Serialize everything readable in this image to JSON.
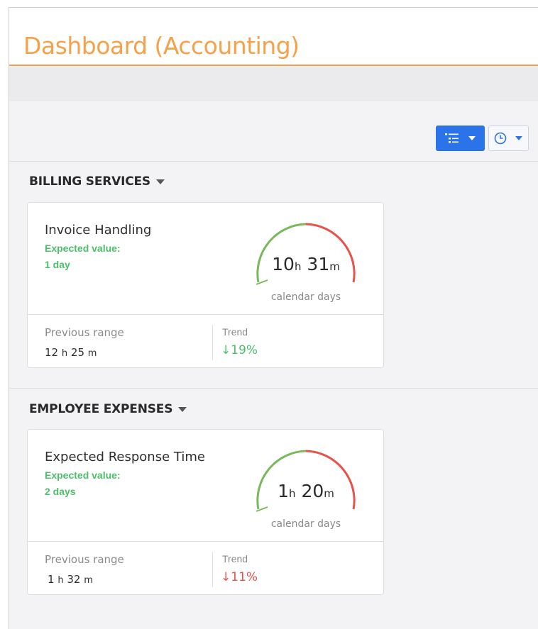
{
  "page": {
    "title": "Dashboard (Accounting)"
  },
  "toolbar": {
    "view_button_icon": "list-tree-icon",
    "time_button_icon": "clock-icon",
    "accent": "#2b73e8"
  },
  "colors": {
    "good": "#4cbf6b",
    "bad": "#e5534b",
    "title": "#f5a14a"
  },
  "sections": [
    {
      "heading": "BILLING SERVICES",
      "card": {
        "title": "Invoice Handling",
        "expected_label": "Expected value:",
        "expected_value": "1 day",
        "gauge_hours": "10",
        "gauge_hours_unit": "h",
        "gauge_minutes": "31",
        "gauge_minutes_unit": "m",
        "gauge_unit_label": "calendar days",
        "previous_label": "Previous range",
        "previous_hours": "12",
        "previous_hours_unit": "h",
        "previous_minutes": "25",
        "previous_minutes_unit": "m",
        "trend_label": "Trend",
        "trend_arrow": "↓",
        "trend_value": "19%",
        "trend_color": "#4cbf6b"
      }
    },
    {
      "heading": "EMPLOYEE EXPENSES",
      "card": {
        "title": "Expected Response Time",
        "expected_label": "Expected value:",
        "expected_value": "2 days",
        "gauge_hours": "1",
        "gauge_hours_unit": "h",
        "gauge_minutes": "20",
        "gauge_minutes_unit": "m",
        "gauge_unit_label": "calendar days",
        "previous_label": "Previous range",
        "previous_hours": "1",
        "previous_hours_unit": "h",
        "previous_minutes": "32",
        "previous_minutes_unit": "m",
        "trend_label": "Trend",
        "trend_arrow": "↓",
        "trend_value": "11%",
        "trend_color": "#e5534b"
      }
    }
  ]
}
